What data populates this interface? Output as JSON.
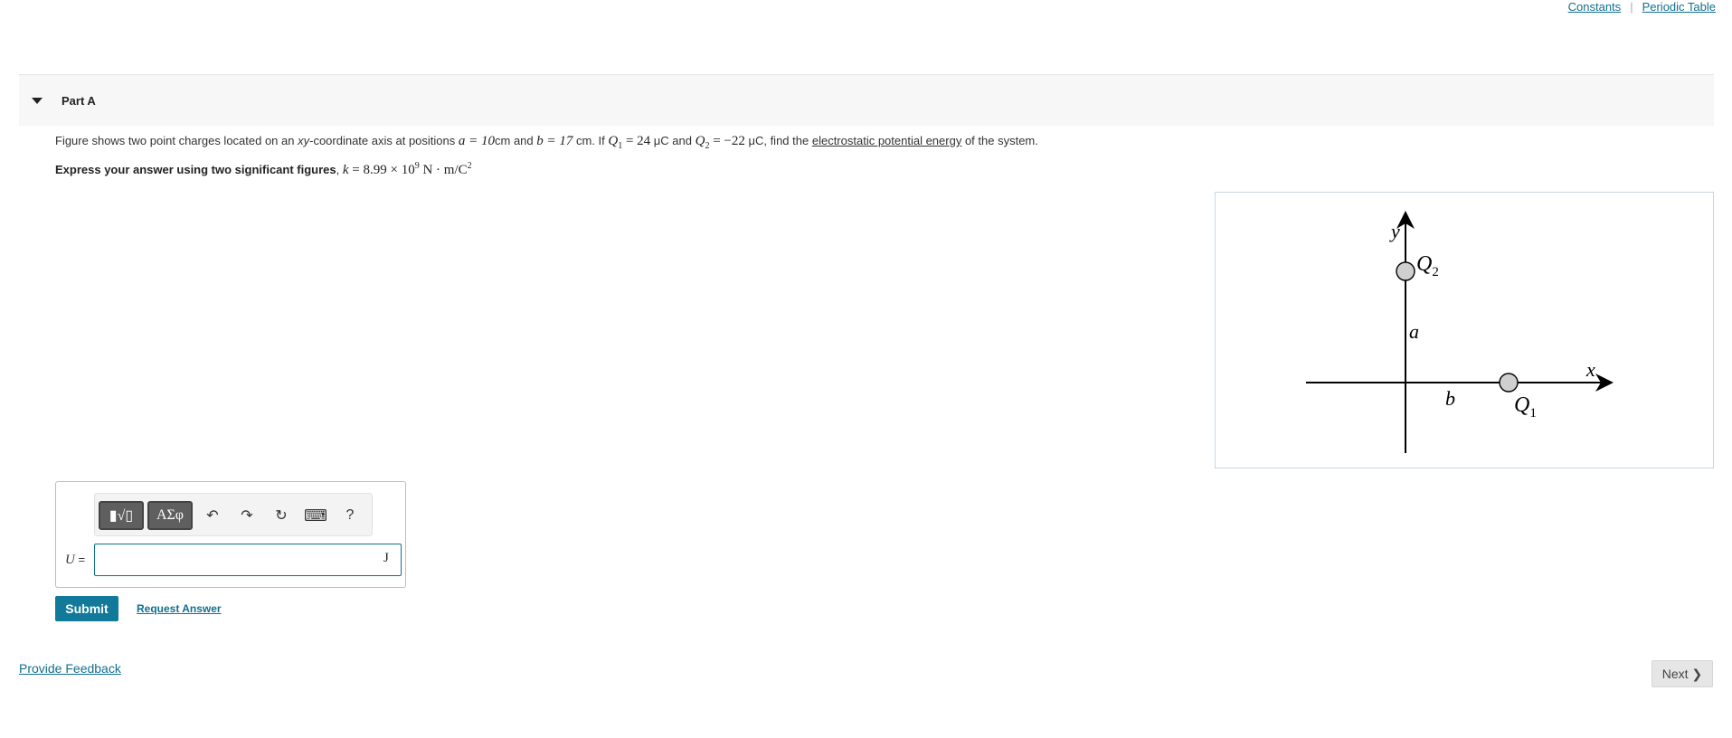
{
  "top_links": {
    "constants": "Constants",
    "separator": "|",
    "periodic_table": "Periodic Table"
  },
  "part": {
    "title": "Part A"
  },
  "question": {
    "pre": "Figure shows two point charges located on an ",
    "xy": "xy",
    "mid1": "-coordinate axis at positions ",
    "a_expr": "a = 10",
    "cm1": "cm and ",
    "b_expr": "b = 17",
    "cm2": " cm. If ",
    "q1_expr": "Q",
    "q1_sub": "1",
    "q1_val": " = 24",
    "uc1": " μC and ",
    "q2_expr": "Q",
    "q2_sub": "2",
    "q2_val": " = −22",
    "uc2": " μC, find the ",
    "link": "electrostatic potential energy",
    "post": " of the system."
  },
  "instruction": {
    "bold": "Express your answer using two significant figures",
    "comma": ", ",
    "k_expr": "k",
    "k_val": " = 8.99 × 10",
    "k_exp": "9",
    "k_unit": " N · m/C",
    "k_unit_exp": "2"
  },
  "figure": {
    "y_label": "y",
    "x_label": "x",
    "q2_label": "Q",
    "q2_sub": "2",
    "q1_label": "Q",
    "q1_sub": "1",
    "a_label": "a",
    "b_label": "b"
  },
  "answer": {
    "toolbar": {
      "templates_glyph": "▮√▯",
      "symbols_glyph": "ΑΣφ",
      "undo_glyph": "↶",
      "redo_glyph": "↷",
      "reset_glyph": "↻",
      "keyboard_glyph": "⌨",
      "help_glyph": "?"
    },
    "variable": "U",
    "equals": " =",
    "value": "",
    "unit": "J"
  },
  "buttons": {
    "submit": "Submit",
    "request_answer": "Request Answer",
    "feedback": "Provide Feedback",
    "next": "Next",
    "next_glyph": "❯"
  }
}
